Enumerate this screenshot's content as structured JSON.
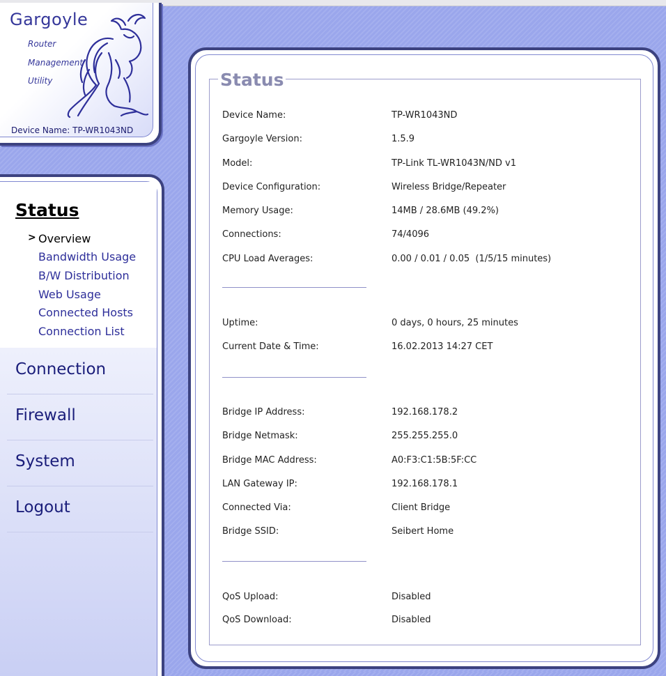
{
  "logo": {
    "title": "Gargoyle",
    "subtitle_lines": [
      "Router",
      "Management",
      "Utility"
    ],
    "device_name": "Device Name: TP-WR1043ND"
  },
  "nav": {
    "current_section": "Status",
    "subitems": [
      {
        "label": "Overview",
        "active": true,
        "marker": ">"
      },
      {
        "label": "Bandwidth Usage"
      },
      {
        "label": "B/W Distribution"
      },
      {
        "label": "Web Usage"
      },
      {
        "label": "Connected Hosts"
      },
      {
        "label": "Connection List"
      }
    ],
    "sections": [
      "Connection",
      "Firewall",
      "System",
      "Logout"
    ]
  },
  "status": {
    "legend": "Status",
    "groups": [
      [
        {
          "label": "Device Name:",
          "value": "TP-WR1043ND"
        },
        {
          "label": "Gargoyle Version:",
          "value": "1.5.9"
        },
        {
          "label": "Model:",
          "value": "TP-Link TL-WR1043N/ND v1"
        },
        {
          "label": "Device Configuration:",
          "value": "Wireless Bridge/Repeater"
        },
        {
          "label": "Memory Usage:",
          "value": "14MB / 28.6MB (49.2%)"
        },
        {
          "label": "Connections:",
          "value": "74/4096"
        },
        {
          "label": "CPU Load Averages:",
          "value": "0.00 / 0.01 / 0.05  (1/5/15 minutes)"
        }
      ],
      [
        {
          "label": "Uptime:",
          "value": "0 days, 0 hours, 25 minutes"
        },
        {
          "label": "Current Date & Time:",
          "value": "16.02.2013 14:27 CET"
        }
      ],
      [
        {
          "label": "Bridge IP Address:",
          "value": "192.168.178.2"
        },
        {
          "label": "Bridge Netmask:",
          "value": "255.255.255.0"
        },
        {
          "label": "Bridge MAC Address:",
          "value": "A0:F3:C1:5B:5F:CC"
        },
        {
          "label": "LAN Gateway IP:",
          "value": "192.168.178.1"
        },
        {
          "label": "Connected Via:",
          "value": "Client Bridge"
        },
        {
          "label": "Bridge SSID:",
          "value": "Seibert Home"
        }
      ],
      [
        {
          "label": "QoS Upload:",
          "value": "Disabled"
        },
        {
          "label": "QoS Download:",
          "value": "Disabled"
        }
      ]
    ]
  },
  "colors": {
    "background": "#9aa6ec",
    "border": "#3c4280",
    "nav_text": "#2e2f9a",
    "legend": "#8a8bb0"
  }
}
